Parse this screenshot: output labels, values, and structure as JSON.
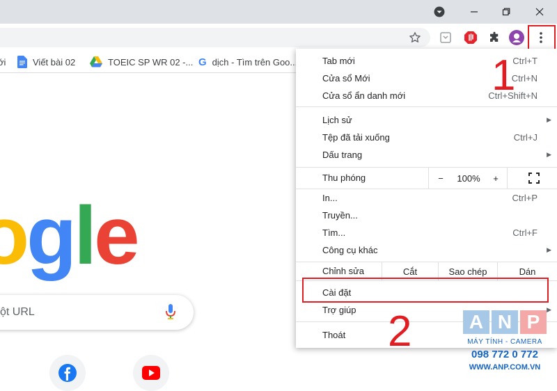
{
  "colors": {
    "titlebar": "#dee1e6",
    "highlight": "#e11d22",
    "google_blue": "#4285f4",
    "google_red": "#ea4335",
    "google_yellow": "#fbbc05",
    "google_green": "#34a853",
    "anp_box": "#a8c8e8",
    "anp_text": "#1565c0"
  },
  "window_controls": {
    "profile_icon": "profile-dropdown-icon",
    "minimize_icon": "minimize-icon",
    "restore_icon": "restore-icon",
    "close_icon": "close-icon"
  },
  "toolbar": {
    "icons": [
      "star-icon",
      "reading-list-icon",
      "adblock-icon",
      "extensions-icon",
      "avatar",
      "kebab-menu-icon"
    ]
  },
  "bookmarks": [
    {
      "label": "ới",
      "icon": "none"
    },
    {
      "label": "Viết bài 02",
      "icon": "google-docs-icon"
    },
    {
      "label": "TOEIC SP WR 02 -...",
      "icon": "google-drive-icon"
    },
    {
      "label": "dịch - Tìm trên Goo...",
      "icon": "google-icon"
    }
  ],
  "newtab": {
    "logo_text": "ogle",
    "search_placeholder": "ột URL",
    "shortcuts": [
      "facebook-icon",
      "youtube-icon"
    ]
  },
  "menu": {
    "items": {
      "new_tab": {
        "label": "Tab mới",
        "shortcut": "Ctrl+T"
      },
      "new_window": {
        "label": "Cửa sổ Mới",
        "shortcut": "Ctrl+N"
      },
      "incognito": {
        "label": "Cửa sổ ẩn danh mới",
        "shortcut": "Ctrl+Shift+N"
      },
      "history": {
        "label": "Lịch sử"
      },
      "downloads": {
        "label": "Tệp đã tải xuống",
        "shortcut": "Ctrl+J"
      },
      "bookmarks": {
        "label": "Dấu trang"
      },
      "print": {
        "label": "In...",
        "shortcut": "Ctrl+P"
      },
      "cast": {
        "label": "Truyền..."
      },
      "find": {
        "label": "Tìm...",
        "shortcut": "Ctrl+F"
      },
      "more_tools": {
        "label": "Công cụ khác"
      },
      "settings": {
        "label": "Cài đặt"
      },
      "help": {
        "label": "Trợ giúp"
      },
      "exit": {
        "label": "Thoát"
      }
    },
    "zoom": {
      "label": "Thu phóng",
      "minus": "−",
      "value": "100%",
      "plus": "+"
    },
    "edit": {
      "label": "Chỉnh sửa",
      "cut": "Cắt",
      "copy": "Sao chép",
      "paste": "Dán"
    }
  },
  "annotations": {
    "step1": "1",
    "step2": "2"
  },
  "watermark": {
    "letters": [
      "A",
      "N",
      "P"
    ],
    "tagline": "MÁY TÍNH - CAMERA",
    "phone": "098 772 0 772",
    "website": "WWW.ANP.COM.VN"
  }
}
